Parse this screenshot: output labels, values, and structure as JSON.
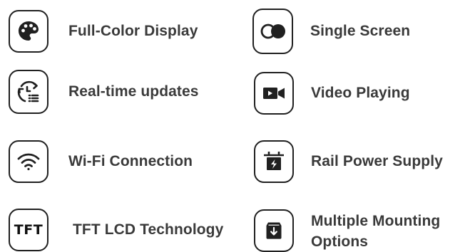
{
  "features": [
    {
      "id": "full-color-display",
      "label": "Full-Color Display",
      "icon": "palette-icon"
    },
    {
      "id": "single-screen",
      "label": "Single  Screen",
      "icon": "toggle-circles-icon"
    },
    {
      "id": "real-time-updates",
      "label": "Real-time updates",
      "icon": "refresh-list-icon"
    },
    {
      "id": "video-playing",
      "label": "Video Playing",
      "icon": "video-camera-icon"
    },
    {
      "id": "wifi-connection",
      "label": "Wi-Fi Connection",
      "icon": "wifi-icon"
    },
    {
      "id": "rail-power-supply",
      "label": "Rail Power Supply",
      "icon": "battery-bolt-icon"
    },
    {
      "id": "tft-lcd-technology",
      "label": "TFT LCD  Technology",
      "icon": "tft-text-icon",
      "icon_text": "TFT"
    },
    {
      "id": "multiple-mounting-options",
      "label": "Multiple Mounting Options",
      "icon": "box-download-icon"
    }
  ],
  "colors": {
    "icon_stroke": "#202020",
    "text": "#3a3a3a",
    "background": "#ffffff"
  }
}
